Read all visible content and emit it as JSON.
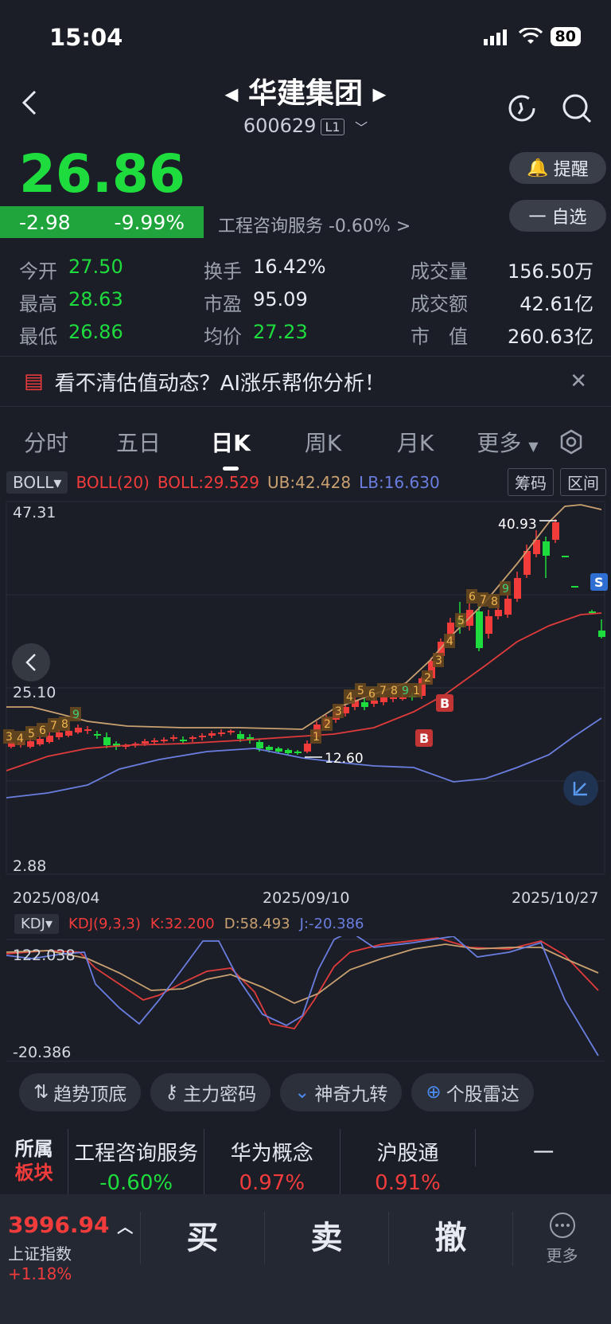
{
  "status": {
    "time": "15:04",
    "battery": "80"
  },
  "header": {
    "name": "华建集团",
    "code": "600629",
    "level": "L1"
  },
  "quote": {
    "price": "26.86",
    "change": "-2.98",
    "change_pct": "-9.99%",
    "sector_text": "工程咨询服务 -0.60% >"
  },
  "buttons": {
    "alert": "提醒",
    "watchlist": "一 自选"
  },
  "stats": [
    {
      "l1": "今开",
      "v1": "27.50",
      "l2": "换手",
      "v2": "16.42%",
      "l3": "成交量",
      "v3": "156.50万"
    },
    {
      "l1": "最高",
      "v1": "28.63",
      "l2": "市盈",
      "v2": "95.09",
      "l3": "成交额",
      "v3": "42.61亿"
    },
    {
      "l1": "最低",
      "v1": "26.86",
      "l2": "均价",
      "v2": "27.23",
      "l3": "市　值",
      "v3": "260.63亿"
    }
  ],
  "banner": {
    "text": "看不清估值动态？AI涨乐帮你分析！"
  },
  "tabs": [
    "分时",
    "五日",
    "日K",
    "周K",
    "月K",
    "更多"
  ],
  "indicator": {
    "name": "BOLL",
    "boll20": "BOLL(20)",
    "boll": "BOLL:29.529",
    "ub": "UB:42.428",
    "lb": "LB:16.630",
    "btn1": "筹码",
    "btn2": "区间"
  },
  "chart_data": [
    {
      "type": "candlestick",
      "title": "日K BOLL(20)",
      "y_max_label": "47.31",
      "y_mid_label": "25.10",
      "y_min_label": "2.88",
      "x_labels": [
        "2025/08/04",
        "2025/09/10",
        "2025/10/27"
      ],
      "annotations": {
        "high": "40.93",
        "low": "12.60"
      },
      "series": [
        {
          "name": "UB",
          "color": "#c9a070"
        },
        {
          "name": "BOLL",
          "color": "#e03b3b"
        },
        {
          "name": "LB",
          "color": "#6a7ee0"
        }
      ]
    },
    {
      "type": "line",
      "title": "KDJ(9,3,3)",
      "y_max_label": "122.038",
      "y_min_label": "-20.386",
      "series": [
        {
          "name": "K:32.200",
          "color": "#e03b3b"
        },
        {
          "name": "D:58.493",
          "color": "#c9a070"
        },
        {
          "name": "J:-20.386",
          "color": "#6a7ee0"
        }
      ]
    }
  ],
  "kdj": {
    "name": "KDJ",
    "params": "KDJ(9,3,3)",
    "k": "K:32.200",
    "d": "D:58.493",
    "j": "J:-20.386"
  },
  "tools": [
    "趋势顶底",
    "主力密码",
    "神奇九转",
    "个股雷达"
  ],
  "sectors": {
    "label1": "所属",
    "label2": "板块",
    "items": [
      {
        "name": "工程咨询服务",
        "pct": "-0.60%"
      },
      {
        "name": "华为概念",
        "pct": "0.97%"
      },
      {
        "name": "沪股通",
        "pct": "0.91%"
      }
    ]
  },
  "bottom": {
    "index_value": "3996.94",
    "index_name": "上证指数",
    "index_pct": "+1.18%",
    "buy": "买",
    "sell": "卖",
    "cancel": "撤",
    "more": "更多"
  }
}
